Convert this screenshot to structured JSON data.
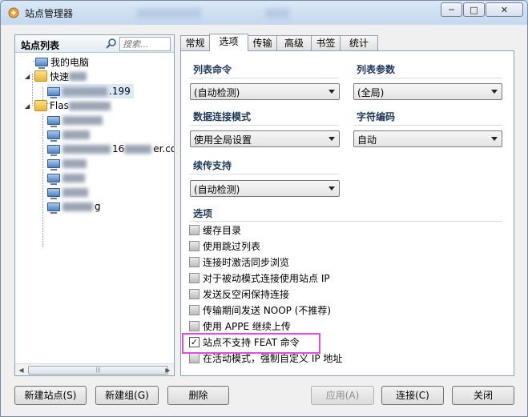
{
  "window": {
    "title": "站点管理器",
    "controls": {
      "minimize": "─",
      "maximize": "□",
      "close": "✕"
    }
  },
  "site_list": {
    "title": "站点列表",
    "search_placeholder": "搜索...",
    "tree": {
      "my_computer": "我的电脑",
      "quick_folder": "快速",
      "quick_site_suffix": ".199",
      "flash_folder": "Flas",
      "site_suffix_a": "16",
      "site_suffix_b": "er.co",
      "site_suffix_c": "g"
    }
  },
  "tabs": [
    "常规",
    "选项",
    "传输",
    "高级",
    "书签",
    "统计"
  ],
  "active_tab": "选项",
  "options": {
    "list_command": {
      "label": "列表命令",
      "value": "(自动检测)"
    },
    "list_params": {
      "label": "列表参数",
      "value": "(全局)"
    },
    "data_mode": {
      "label": "数据连接模式",
      "value": "使用全局设置"
    },
    "charset": {
      "label": "字符编码",
      "value": "自动"
    },
    "resume": {
      "label": "续传支持",
      "value": "(自动检测)"
    },
    "section_title": "选项",
    "checkboxes": [
      {
        "label": "缓存目录",
        "checked": false
      },
      {
        "label": "使用跳过列表",
        "checked": false
      },
      {
        "label": "连接时激活同步浏览",
        "checked": false
      },
      {
        "label": "对于被动模式连接使用站点 IP",
        "checked": false
      },
      {
        "label": "发送反空闲保持连接",
        "checked": false
      },
      {
        "label": "传输期间发送 NOOP (不推荐)",
        "checked": false
      },
      {
        "label": "使用 APPE 继续上传",
        "checked": false
      },
      {
        "label": "站点不支持 FEAT 命令",
        "checked": true
      },
      {
        "label": "在活动模式，强制自定义 IP 地址",
        "checked": false
      }
    ]
  },
  "buttons": {
    "new_site": "新建站点(S)",
    "new_group": "新建组(G)",
    "delete": "删除",
    "apply": "应用(A)",
    "connect": "连接(C)",
    "close": "关闭"
  }
}
